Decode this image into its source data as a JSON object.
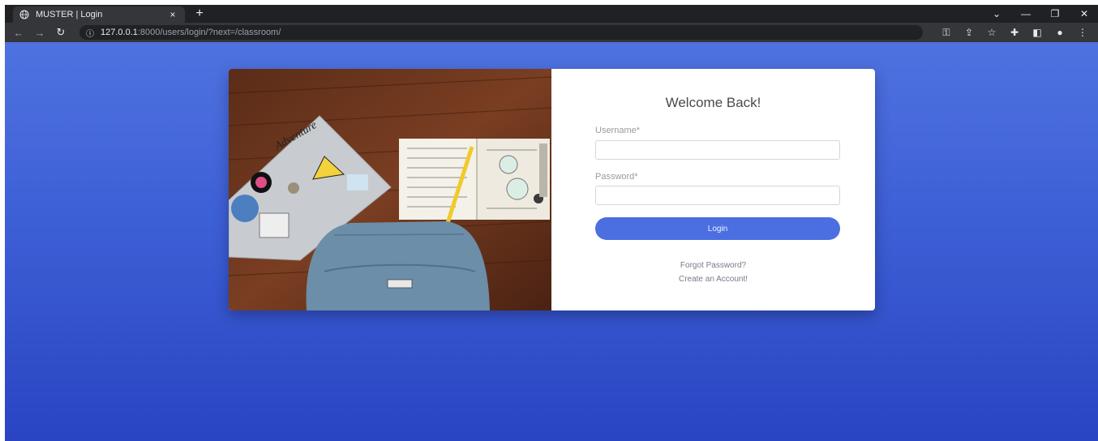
{
  "browser": {
    "tab_title": "MUSTER | Login",
    "tab_close": "×",
    "new_tab": "+",
    "url_host": "127.0.0.1",
    "url_path": ":8000/users/login/?next=/classroom/",
    "icons": [
      "globe-icon",
      "back-icon",
      "forward-icon",
      "reload-icon",
      "info-icon",
      "key-icon",
      "share-icon",
      "star-icon",
      "extensions-icon",
      "sidepanel-icon",
      "profile-icon",
      "menu-icon"
    ]
  },
  "login": {
    "welcome": "Welcome Back!",
    "username_label": "Username*",
    "password_label": "Password*",
    "username_value": "",
    "password_value": "",
    "login_button": "Login",
    "forgot_link": "Forgot Password?",
    "create_link": "Create an Account!"
  },
  "colors": {
    "page_bg_top": "#4f72e0",
    "page_bg_bottom": "#2a44c2",
    "button": "#4b6fe0"
  }
}
